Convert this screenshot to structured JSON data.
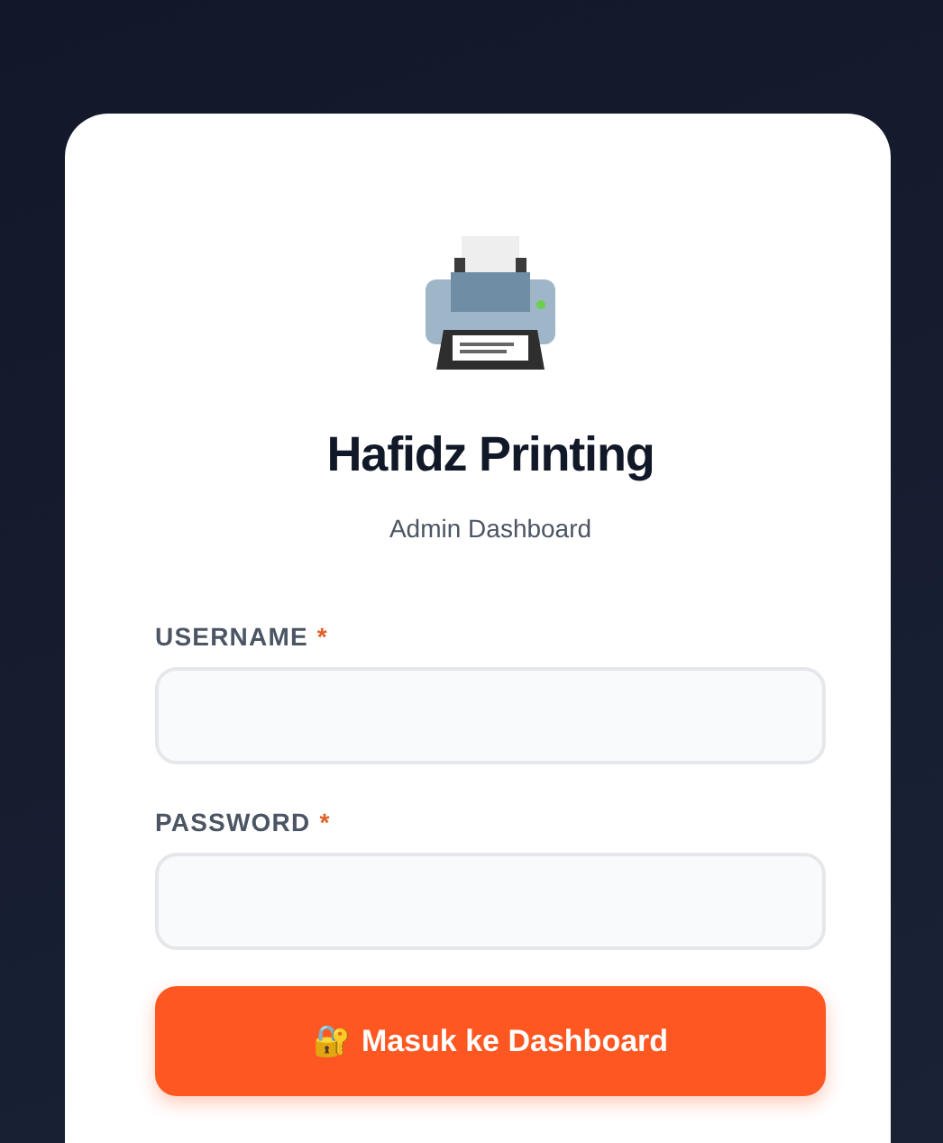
{
  "brand": {
    "title": "Hafidz Printing",
    "subtitle": "Admin Dashboard"
  },
  "fields": [
    {
      "label": "USERNAME",
      "required_mark": "*"
    },
    {
      "label": "PASSWORD",
      "required_mark": "*"
    }
  ],
  "submit": {
    "icon": "🔐",
    "label": "Masuk ke Dashboard"
  }
}
